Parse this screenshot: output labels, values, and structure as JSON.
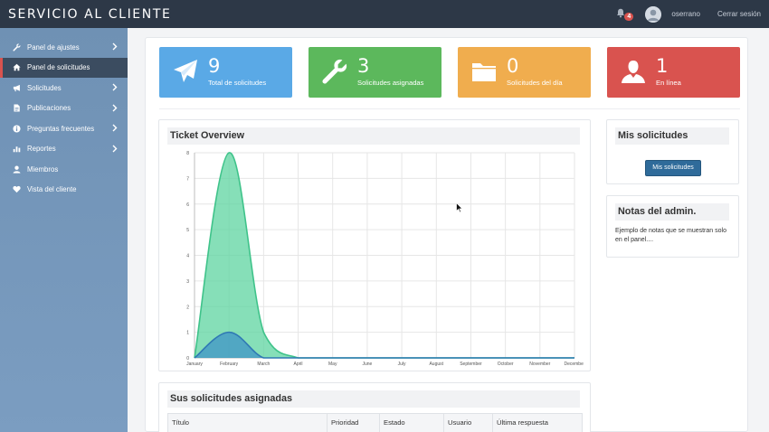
{
  "app": {
    "title": "SERVICIO AL CLIENTE"
  },
  "topbar": {
    "notifications_count": "4",
    "username": "oserrano",
    "logout_label": "Cerrar sesión"
  },
  "sidebar": {
    "items": [
      {
        "label": "Panel de ajustes",
        "icon": "wrench-icon",
        "has_submenu": true
      },
      {
        "label": "Panel de solicitudes",
        "icon": "home-icon",
        "has_submenu": false,
        "active": true
      },
      {
        "label": "Solicitudes",
        "icon": "megaphone-icon",
        "has_submenu": true
      },
      {
        "label": "Publicaciones",
        "icon": "file-icon",
        "has_submenu": true
      },
      {
        "label": "Preguntas frecuentes",
        "icon": "info-icon",
        "has_submenu": true
      },
      {
        "label": "Reportes",
        "icon": "bar-chart-icon",
        "has_submenu": true
      },
      {
        "label": "Miembros",
        "icon": "user-icon",
        "has_submenu": false
      },
      {
        "label": "Vista del cliente",
        "icon": "heart-icon",
        "has_submenu": false
      }
    ]
  },
  "stats": [
    {
      "value": "9",
      "label": "Total de solicitudes",
      "icon": "paper-plane-icon",
      "color": "#5aa9e6"
    },
    {
      "value": "3",
      "label": "Solicitudes asignadas",
      "icon": "wrench-icon",
      "color": "#5cb85c"
    },
    {
      "value": "0",
      "label": "Solicitudes del día",
      "icon": "folder-icon",
      "color": "#f0ad4e"
    },
    {
      "value": "1",
      "label": "En línea",
      "icon": "user-icon",
      "color": "#d9534f"
    }
  ],
  "chart_panel": {
    "title": "Ticket Overview"
  },
  "chart_data": {
    "type": "area",
    "title": "Ticket Overview",
    "categories": [
      "January",
      "February",
      "March",
      "April",
      "May",
      "June",
      "July",
      "August",
      "September",
      "October",
      "November",
      "December"
    ],
    "series": [
      {
        "values": [
          0,
          8,
          1,
          0,
          0,
          0,
          0,
          0,
          0,
          0,
          0,
          0
        ],
        "color": "#5ed4a0"
      },
      {
        "values": [
          0,
          1,
          0,
          0,
          0,
          0,
          0,
          0,
          0,
          0,
          0,
          0
        ],
        "color": "#3a8fc8"
      }
    ],
    "ylim": [
      0,
      8
    ],
    "yticks": [
      "0",
      "1",
      "2",
      "3",
      "4",
      "5",
      "6",
      "7",
      "8"
    ],
    "grid": true,
    "legend": "none"
  },
  "mis_panel": {
    "title": "Mis solicitudes",
    "button_label": "Mis solicitudes"
  },
  "notas_panel": {
    "title": "Notas del admin.",
    "text": "Ejemplo de notas que se muestran solo en el panel...."
  },
  "table_panel": {
    "title": "Sus solicitudes asignadas",
    "columns": [
      "Título",
      "Prioridad",
      "Estado",
      "Usuario",
      "Última respuesta"
    ]
  }
}
